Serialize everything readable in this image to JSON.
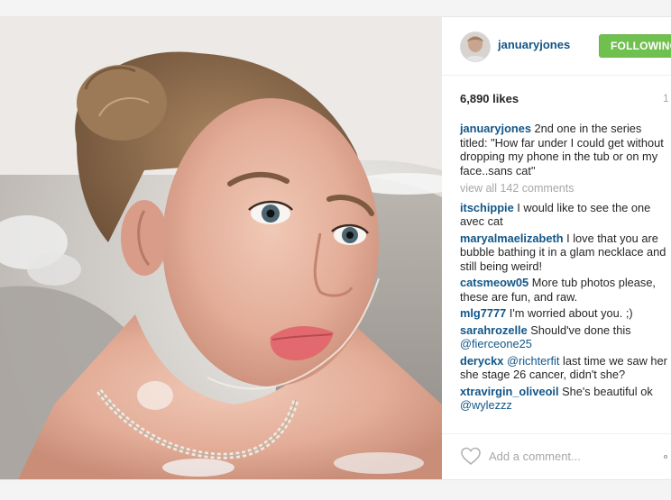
{
  "post": {
    "username": "januaryjones",
    "follow_label": "FOLLOWING",
    "likes": "6,890 likes",
    "time_ago": "1",
    "caption": {
      "author": "januaryjones",
      "text": "2nd one in the series titled: \"How far under I could get without dropping my phone in the tub or on my face..sans cat\""
    },
    "view_all_comments": "view all 142 comments",
    "comments": [
      {
        "author": "itschippie",
        "parts": [
          {
            "text": "I would like to see the one avec cat"
          }
        ]
      },
      {
        "author": "maryalmaelizabeth",
        "parts": [
          {
            "text": "I love that you are bubble bathing it in a glam necklace and still being weird!"
          }
        ]
      },
      {
        "author": "catsmeow05",
        "parts": [
          {
            "text": "More tub photos please, these are fun, and raw."
          }
        ]
      },
      {
        "author": "mlg7777",
        "parts": [
          {
            "text": "I'm worried about you. ;)"
          }
        ]
      },
      {
        "author": "sarahrozelle",
        "parts": [
          {
            "text": "Should've done this "
          },
          {
            "mention": "@fierceone25"
          }
        ]
      },
      {
        "author": "deryckx",
        "parts": [
          {
            "mention": "@richterfit"
          },
          {
            "text": " last time we saw her she stage 26 cancer, didn't she?"
          }
        ]
      },
      {
        "author": "xtravirgin_oliveoil",
        "parts": [
          {
            "text": "She's beautiful ok "
          },
          {
            "mention": "@wylezzz"
          }
        ]
      }
    ],
    "comment_placeholder": "Add a comment...",
    "icons": {
      "like": "heart-icon",
      "options": "more-options-icon"
    },
    "colors": {
      "link": "#125688",
      "follow_button": "#70c050",
      "muted": "#a5a7aa",
      "text": "#262626"
    }
  }
}
